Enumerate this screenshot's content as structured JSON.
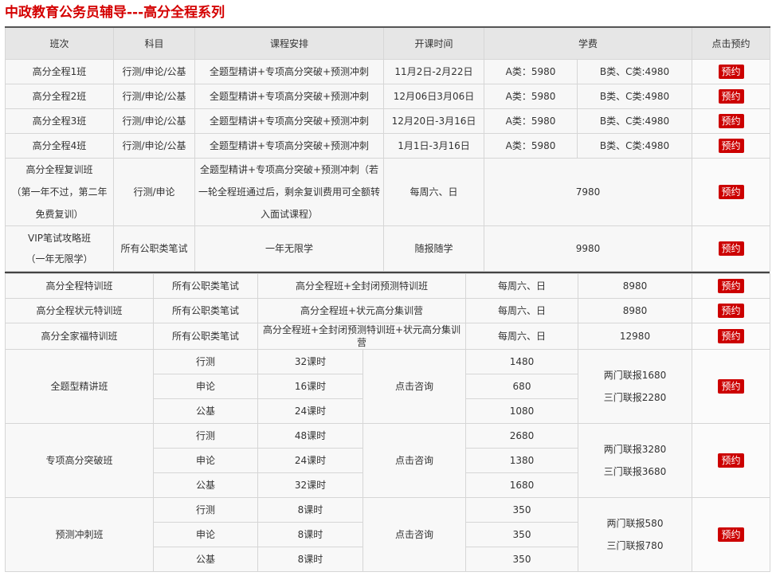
{
  "page_title": "中政教育公务员辅导---高分全程系列",
  "button_label": "预约",
  "accent_color": "#cc0000",
  "headers": [
    "班次",
    "科目",
    "课程安排",
    "开课时间",
    "学费",
    "点击预约"
  ],
  "basic_classes": [
    {
      "name": "高分全程1班",
      "subject": "行测/申论/公基",
      "schedule": "全题型精讲+专项高分突破+预测冲刺",
      "time": "11月2日-2月22日",
      "fee_a": "A类：5980",
      "fee_bc": "B类、C类:4980"
    },
    {
      "name": "高分全程2班",
      "subject": "行测/申论/公基",
      "schedule": "全题型精讲+专项高分突破+预测冲刺",
      "time": "12月06日3月06日",
      "fee_a": "A类：5980",
      "fee_bc": "B类、C类:4980"
    },
    {
      "name": "高分全程3班",
      "subject": "行测/申论/公基",
      "schedule": "全题型精讲+专项高分突破+预测冲刺",
      "time": "12月20日-3月16日",
      "fee_a": "A类：5980",
      "fee_bc": "B类、C类:4980"
    },
    {
      "name": "高分全程4班",
      "subject": "行测/申论/公基",
      "schedule": "全题型精讲+专项高分突破+预测冲刺",
      "time": "1月1日-3月16日",
      "fee_a": "A类：5980",
      "fee_bc": "B类、C类:4980"
    }
  ],
  "retrain_class": {
    "name_line1": "高分全程复训班",
    "name_line2": "（第一年不过，第二年免费复训）",
    "subject": "行测/申论",
    "schedule": "全题型精讲+专项高分突破+预测冲刺（若一轮全程班通过后，剩余复训费用可全额转入面试课程）",
    "time": "每周六、日",
    "fee": "7980"
  },
  "vip_class": {
    "name_line1": "VIP笔试攻略班",
    "name_line2": "（一年无限学）",
    "subject": "所有公职类笔试",
    "schedule": "一年无限学",
    "time": "随报随学",
    "fee": "9980"
  },
  "special_classes": [
    {
      "name": "高分全程特训班",
      "subject": "所有公职类笔试",
      "schedule": "高分全程班+全封闭预测特训班",
      "time": "每周六、日",
      "fee": "8980"
    },
    {
      "name": "高分全程状元特训班",
      "subject": "所有公职类笔试",
      "schedule": "高分全程班+状元高分集训营",
      "time": "每周六、日",
      "fee": "8980"
    },
    {
      "name": "高分全家福特训班",
      "subject": "所有公职类笔试",
      "schedule": "高分全程班+全封闭预测特训班+状元高分集训营",
      "time": "每周六、日",
      "fee": "12980"
    }
  ],
  "module_classes": [
    {
      "name": "全题型精讲班",
      "consult": "点击咨询",
      "combo1": "两门联报1680",
      "combo2": "三门联报2280",
      "rows": [
        {
          "subject": "行测",
          "hours": "32课时",
          "fee": "1480"
        },
        {
          "subject": "申论",
          "hours": "16课时",
          "fee": "680"
        },
        {
          "subject": "公基",
          "hours": "24课时",
          "fee": "1080"
        }
      ]
    },
    {
      "name": "专项高分突破班",
      "consult": "点击咨询",
      "combo1": "两门联报3280",
      "combo2": "三门联报3680",
      "rows": [
        {
          "subject": "行测",
          "hours": "48课时",
          "fee": "2680"
        },
        {
          "subject": "申论",
          "hours": "24课时",
          "fee": "1380"
        },
        {
          "subject": "公基",
          "hours": "32课时",
          "fee": "1680"
        }
      ]
    },
    {
      "name": "预测冲刺班",
      "consult": "点击咨询",
      "combo1": "两门联报580",
      "combo2": "三门联报780",
      "rows": [
        {
          "subject": "行测",
          "hours": "8课时",
          "fee": "350"
        },
        {
          "subject": "申论",
          "hours": "8课时",
          "fee": "350"
        },
        {
          "subject": "公基",
          "hours": "8课时",
          "fee": "350"
        }
      ]
    }
  ]
}
